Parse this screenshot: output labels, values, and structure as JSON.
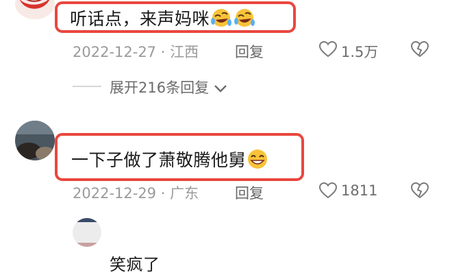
{
  "comments": [
    {
      "text": "听话点，来声妈咪",
      "emoji": [
        "rolling-laugh-emoji",
        "rolling-laugh-emoji"
      ],
      "date": "2022-12-27",
      "separator": "·",
      "location": "江西",
      "reply_label": "回复",
      "likes": "1.5万",
      "replies_toggle": "展开216条回复"
    },
    {
      "text": "一下子做了萧敬腾他舅",
      "emoji": [
        "grin-emoji"
      ],
      "date": "2022-12-29",
      "separator": "·",
      "location": "广东",
      "reply_label": "回复",
      "likes": "1811"
    },
    {
      "text": "笑疯了"
    }
  ],
  "colors": {
    "highlight_border": "#e8473f",
    "meta_text": "#9a9a9a"
  }
}
